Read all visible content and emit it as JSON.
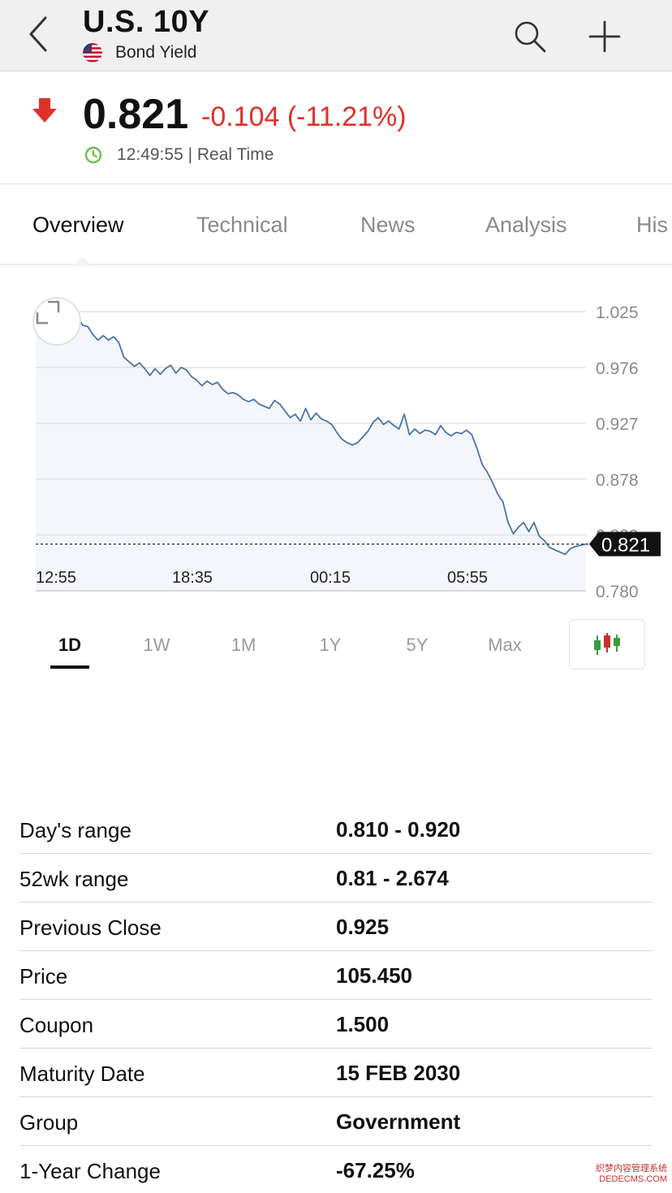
{
  "header": {
    "title": "U.S. 10Y",
    "subtitle": "Bond Yield"
  },
  "quote": {
    "price": "0.821",
    "change": "-0.104 (-11.21%)",
    "time": "12:49:55 | Real Time",
    "change_color": "#e0302a",
    "clock_color": "#6cc04a"
  },
  "tabs": [
    {
      "label": "Overview",
      "active": true
    },
    {
      "label": "Technical",
      "active": false
    },
    {
      "label": "News",
      "active": false
    },
    {
      "label": "Analysis",
      "active": false
    },
    {
      "label": "His",
      "active": false
    }
  ],
  "chart_data": {
    "type": "area",
    "title": "",
    "xlabel": "",
    "ylabel": "",
    "x_ticks": [
      "12:55",
      "18:35",
      "00:15",
      "05:55"
    ],
    "y_ticks": [
      "1.025",
      "0.976",
      "0.927",
      "0.878",
      "0.829",
      "0.780"
    ],
    "ylim": [
      0.78,
      1.025
    ],
    "grid": true,
    "current_value": 0.821,
    "current_label": "0.821",
    "line_color": "#4a74a8",
    "fill_color": "#f4f6fc",
    "values": [
      1.015,
      1.02,
      1.018,
      1.02,
      1.021,
      1.02,
      1.023,
      1.025,
      1.022,
      1.013,
      1.012,
      1.005,
      1.0,
      1.004,
      1.0,
      1.003,
      0.998,
      0.985,
      0.981,
      0.977,
      0.98,
      0.975,
      0.969,
      0.975,
      0.97,
      0.975,
      0.978,
      0.971,
      0.976,
      0.974,
      0.968,
      0.965,
      0.96,
      0.964,
      0.961,
      0.963,
      0.957,
      0.953,
      0.954,
      0.952,
      0.948,
      0.946,
      0.948,
      0.944,
      0.942,
      0.94,
      0.947,
      0.944,
      0.938,
      0.932,
      0.935,
      0.929,
      0.94,
      0.93,
      0.936,
      0.931,
      0.929,
      0.926,
      0.919,
      0.913,
      0.91,
      0.908,
      0.91,
      0.915,
      0.92,
      0.928,
      0.932,
      0.926,
      0.929,
      0.925,
      0.922,
      0.935,
      0.917,
      0.922,
      0.918,
      0.921,
      0.92,
      0.917,
      0.925,
      0.919,
      0.916,
      0.919,
      0.918,
      0.921,
      0.917,
      0.905,
      0.891,
      0.884,
      0.875,
      0.865,
      0.858,
      0.84,
      0.83,
      0.836,
      0.84,
      0.832,
      0.84,
      0.828,
      0.824,
      0.818,
      0.816,
      0.814,
      0.812,
      0.817,
      0.819,
      0.82,
      0.821
    ]
  },
  "ranges": [
    {
      "label": "1D",
      "active": true
    },
    {
      "label": "1W",
      "active": false
    },
    {
      "label": "1M",
      "active": false
    },
    {
      "label": "1Y",
      "active": false
    },
    {
      "label": "5Y",
      "active": false
    },
    {
      "label": "Max",
      "active": false
    }
  ],
  "stats": [
    {
      "label": "Day's range",
      "value": "0.810 - 0.920"
    },
    {
      "label": "52wk range",
      "value": "0.81 - 2.674"
    },
    {
      "label": "Previous Close",
      "value": "0.925"
    },
    {
      "label": "Price",
      "value": "105.450"
    },
    {
      "label": "Coupon",
      "value": "1.500"
    },
    {
      "label": "Maturity Date",
      "value": "15 FEB 2030"
    },
    {
      "label": "Group",
      "value": "Government"
    },
    {
      "label": "1-Year Change",
      "value": "-67.25%"
    }
  ],
  "watermark": {
    "line1": "织梦内容管理系统",
    "line2": "DEDECMS.COM"
  }
}
